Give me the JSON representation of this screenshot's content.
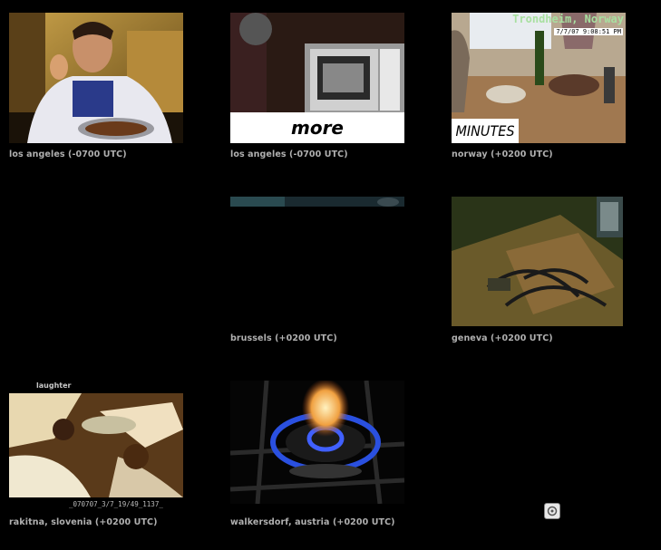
{
  "cells": [
    {
      "caption": "los angeles (-0700 UTC)"
    },
    {
      "caption": "los angeles (-0700 UTC)",
      "banner": "more"
    },
    {
      "caption": "norway (+0200 UTC)",
      "overlay_location": "Trondheim, Norway",
      "timestamp": "7/7/07 9:08:51 PM",
      "banner": "MINUTES"
    },
    {
      "caption": "brussels (+0200 UTC)"
    },
    {
      "caption": "geneva (+0200 UTC)"
    },
    {
      "caption": "rakitna, slovenia (+0200 UTC)",
      "label": "laughter",
      "filename": "_070707_3/7_19/49_1137_"
    },
    {
      "caption": "walkersdorf, austria (+0200 UTC)"
    }
  ],
  "corner_icon": "sound-toggle-icon"
}
